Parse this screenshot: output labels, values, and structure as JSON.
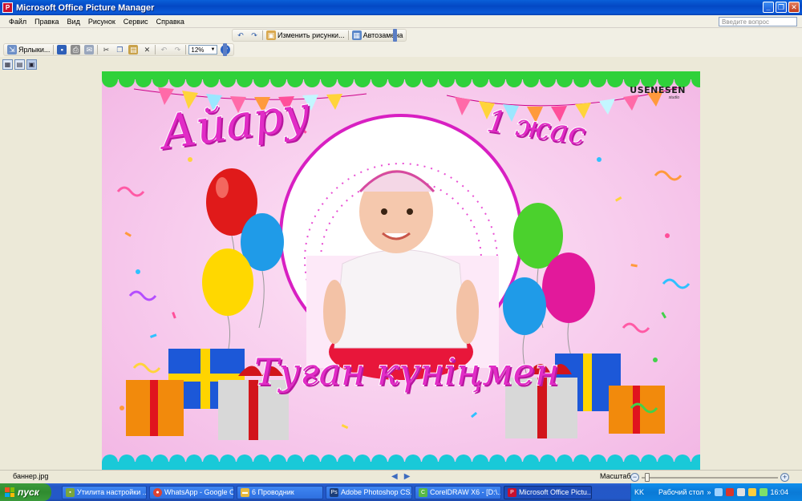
{
  "window": {
    "title": "Microsoft Office Picture Manager",
    "controls": {
      "minimize": "_",
      "restore": "❐",
      "close": "✕"
    }
  },
  "menu": {
    "items": [
      "Файл",
      "Правка",
      "Вид",
      "Рисунок",
      "Сервис",
      "Справка"
    ],
    "help_search_placeholder": "Введите вопрос"
  },
  "toolbar1": {
    "edit_pictures": "Изменить рисунки...",
    "autocorrect": "Автозамена"
  },
  "toolbar2": {
    "shortcuts": "Ярлыки...",
    "zoom_value": "12%"
  },
  "image": {
    "brand": "USENESEN",
    "brand_sub": "studio",
    "name_text": "Айару",
    "age_text": "1 жас",
    "birthday_text": "Туған күніңмен"
  },
  "status": {
    "file_name": "баннер.jpg",
    "zoom_label": "Масштаб:"
  },
  "taskbar": {
    "start_label": "пуск",
    "tasks": [
      "Утилита настройки ...",
      "WhatsApp - Google C...",
      "6 Проводник",
      "Adobe Photoshop CS...",
      "CorelDRAW X6 - [D:\\...",
      "Microsoft Office Pictu..."
    ],
    "tray": {
      "language": "KK",
      "desktop": "Рабочий стол",
      "clock": "16:04"
    }
  },
  "colors": {
    "accent_pink": "#e12cc6",
    "title_blue": "#0348c4",
    "taskbar_blue": "#2457c6",
    "start_green": "#2f8b2f"
  }
}
